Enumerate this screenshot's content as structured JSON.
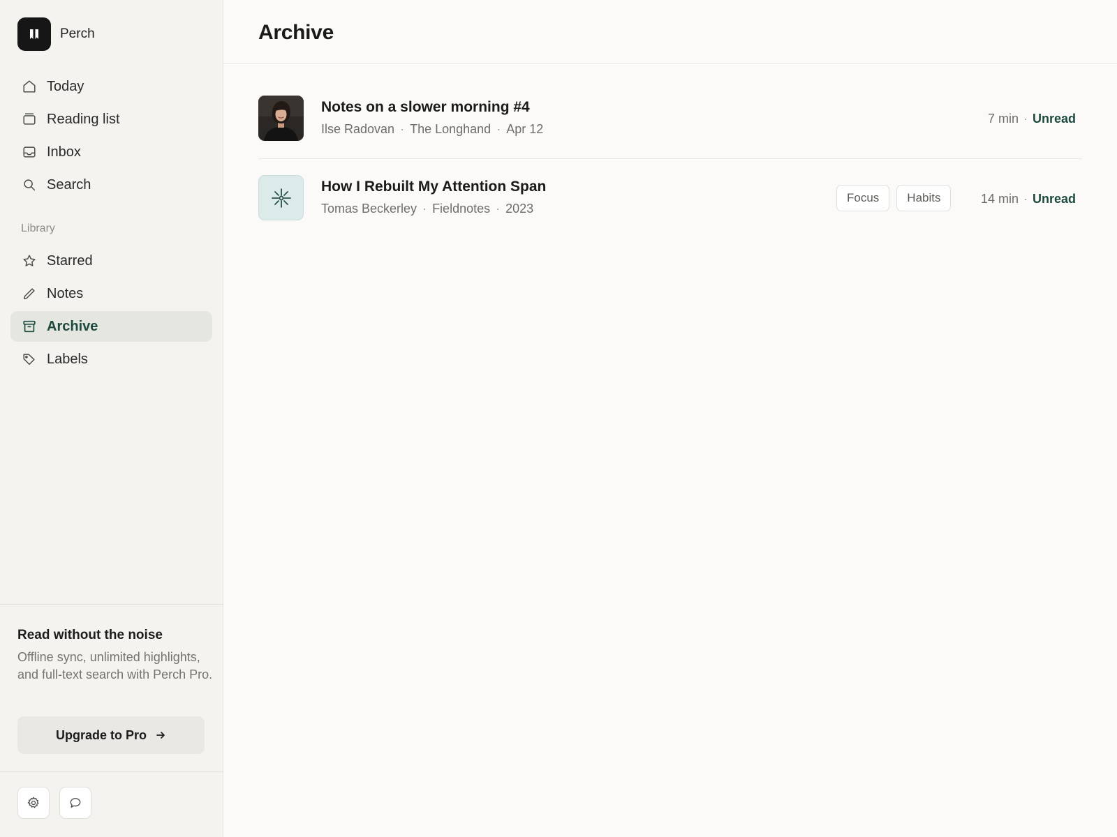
{
  "brand": {
    "name": "Perch"
  },
  "nav": {
    "primary": [
      {
        "label": "Today",
        "icon": "home-icon"
      },
      {
        "label": "Reading list",
        "icon": "reading-list-icon"
      },
      {
        "label": "Inbox",
        "icon": "inbox-icon"
      },
      {
        "label": "Search",
        "icon": "search-icon"
      }
    ],
    "section_label": "Library",
    "library": [
      {
        "label": "Starred",
        "icon": "star-icon"
      },
      {
        "label": "Notes",
        "icon": "pencil-icon"
      },
      {
        "label": "Archive",
        "icon": "archive-icon",
        "active": true
      },
      {
        "label": "Labels",
        "icon": "tag-icon"
      }
    ]
  },
  "promo": {
    "title": "Read without the noise",
    "text": "Offline sync, unlimited highlights, and full-text search with Perch Pro.",
    "button_label": "Upgrade to Pro"
  },
  "footer_buttons": [
    "settings-icon",
    "chat-icon"
  ],
  "main": {
    "title": "Archive",
    "articles": [
      {
        "title": "Notes on a slower morning #4",
        "author": "Ilse Radovan",
        "source": "The Longhand",
        "date": "Apr 12",
        "tags": [],
        "read_time": "7 min",
        "status": "Unread",
        "thumb": "author-photo"
      },
      {
        "title": "How I Rebuilt My Attention Span",
        "author": "Tomas Beckerley",
        "source": "Fieldnotes",
        "date": "2023",
        "tags": [
          "Focus",
          "Habits"
        ],
        "read_time": "14 min",
        "status": "Unread",
        "thumb": "sparkle-icon"
      }
    ]
  },
  "colors": {
    "accent": "#1d4a3f",
    "sidebar_bg": "#f4f3f0",
    "active_bg": "#e5e6e0",
    "thumb_teal": "#dcebe9"
  }
}
